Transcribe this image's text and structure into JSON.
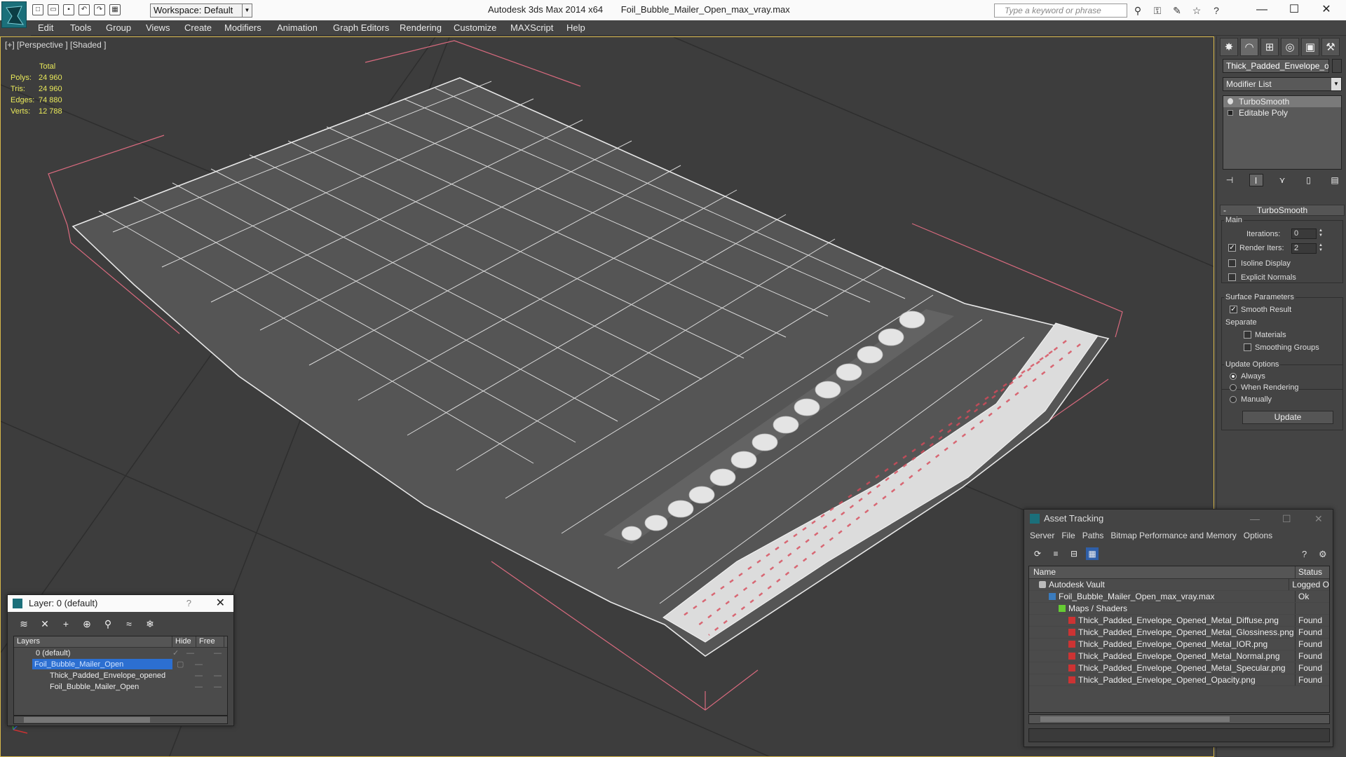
{
  "titlebar": {
    "workspace": "Workspace: Default",
    "app_name": "Autodesk 3ds Max  2014 x64",
    "file_name": "Foil_Bubble_Mailer_Open_max_vray.max",
    "search_placeholder": "Type a keyword or phrase"
  },
  "menu": [
    "Edit",
    "Tools",
    "Group",
    "Views",
    "Create",
    "Modifiers",
    "Animation",
    "Graph Editors",
    "Rendering",
    "Customize",
    "MAXScript",
    "Help"
  ],
  "viewport": {
    "label": "[+] [Perspective ] [Shaded ]",
    "stats": {
      "total_label": "Total",
      "polys_label": "Polys:",
      "polys": "24 960",
      "tris_label": "Tris:",
      "tris": "24 960",
      "edges_label": "Edges:",
      "edges": "74 880",
      "verts_label": "Verts:",
      "verts": "12 788"
    }
  },
  "command_panel": {
    "object_name": "Thick_Padded_Envelope_ope",
    "modifier_list": "Modifier List",
    "stack": [
      "TurboSmooth",
      "Editable Poly"
    ],
    "rollout_title": "TurboSmooth",
    "main_label": "Main",
    "iterations_label": "Iterations:",
    "iterations": "0",
    "render_iters_label": "Render Iters:",
    "render_iters": "2",
    "isoline_label": "Isoline Display",
    "explicit_normals_label": "Explicit Normals",
    "surface_params_label": "Surface Parameters",
    "smooth_result_label": "Smooth Result",
    "separate_label": "Separate",
    "materials_label": "Materials",
    "smoothing_groups_label": "Smoothing Groups",
    "update_options_label": "Update Options",
    "always_label": "Always",
    "when_rendering_label": "When Rendering",
    "manually_label": "Manually",
    "update_button": "Update"
  },
  "layer_dialog": {
    "title": "Layer: 0 (default)",
    "help": "?",
    "col_layers": "Layers",
    "col_hide": "Hide",
    "col_freeze": "Free",
    "rows": [
      "0 (default)",
      "Foil_Bubble_Mailer_Open",
      "Thick_Padded_Envelope_opened",
      "Foil_Bubble_Mailer_Open"
    ]
  },
  "asset_dialog": {
    "title": "Asset Tracking",
    "menu": [
      "Server",
      "File",
      "Paths",
      "Bitmap Performance and Memory",
      "Options"
    ],
    "col_name": "Name",
    "col_status": "Status",
    "rows": [
      {
        "name": "Autodesk Vault",
        "status": "Logged O",
        "type": "vault",
        "indent": 1
      },
      {
        "name": "Foil_Bubble_Mailer_Open_max_vray.max",
        "status": "Ok",
        "type": "max",
        "indent": 2
      },
      {
        "name": "Maps / Shaders",
        "status": "",
        "type": "maps",
        "indent": 3
      },
      {
        "name": "Thick_Padded_Envelope_Opened_Metal_Diffuse.png",
        "status": "Found",
        "type": "png",
        "indent": 4
      },
      {
        "name": "Thick_Padded_Envelope_Opened_Metal_Glossiness.png",
        "status": "Found",
        "type": "png",
        "indent": 4
      },
      {
        "name": "Thick_Padded_Envelope_Opened_Metal_IOR.png",
        "status": "Found",
        "type": "png",
        "indent": 4
      },
      {
        "name": "Thick_Padded_Envelope_Opened_Metal_Normal.png",
        "status": "Found",
        "type": "png",
        "indent": 4
      },
      {
        "name": "Thick_Padded_Envelope_Opened_Metal_Specular.png",
        "status": "Found",
        "type": "png",
        "indent": 4
      },
      {
        "name": "Thick_Padded_Envelope_Opened_Opacity.png",
        "status": "Found",
        "type": "png",
        "indent": 4
      }
    ]
  },
  "colors": {
    "stats_yellow": "#e9e95a",
    "selection_blue": "#2c6fd1",
    "viewport_bg": "#3d3d3d",
    "wire": "#ffffff",
    "bbox": "#d86a7e"
  }
}
